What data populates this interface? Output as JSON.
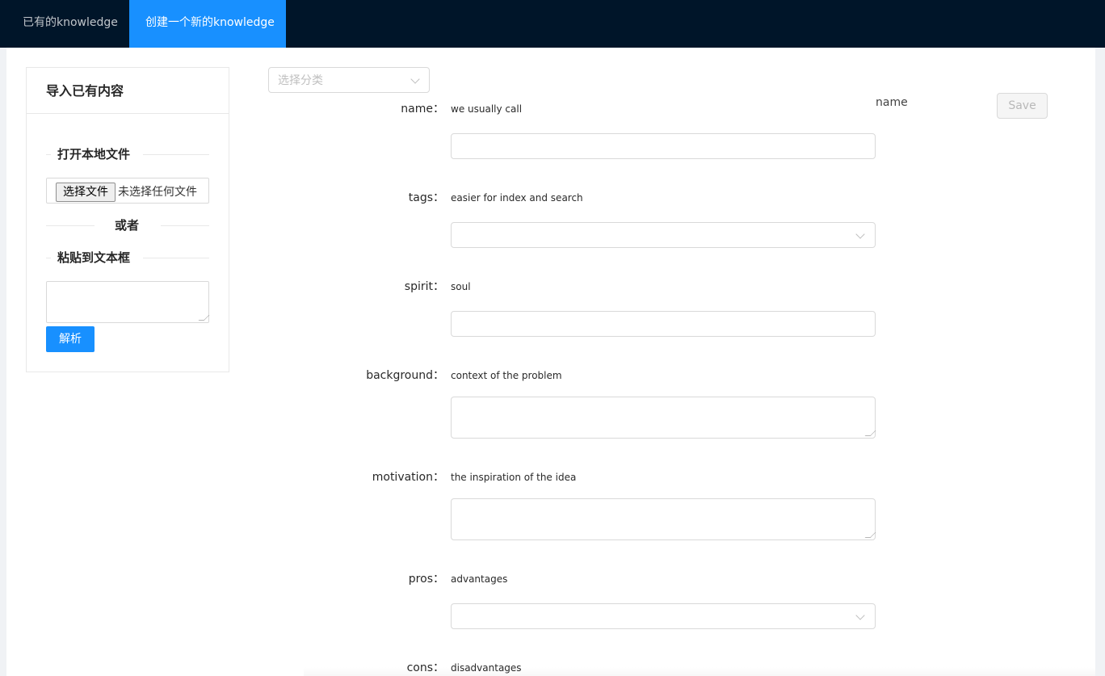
{
  "nav": {
    "tabs": [
      {
        "label": "已有的knowledge",
        "active": false
      },
      {
        "label": "创建一个新的knowledge",
        "active": true
      }
    ]
  },
  "import_panel": {
    "title": "导入已有内容",
    "open_file_label": "打开本地文件",
    "file_button_label": "选择文件",
    "file_status": "未选择任何文件",
    "or_label": "或者",
    "paste_label": "粘贴到文本框",
    "paste_value": "",
    "parse_button_label": "解析"
  },
  "form": {
    "category_placeholder": "选择分类",
    "name_preview": "name",
    "save_label": "Save",
    "fields": [
      {
        "label": "name",
        "hint": "we usually call",
        "type": "input",
        "value": ""
      },
      {
        "label": "tags",
        "hint": "easier for index and search",
        "type": "select",
        "value": ""
      },
      {
        "label": "spirit",
        "hint": "soul",
        "type": "input",
        "value": ""
      },
      {
        "label": "background",
        "hint": "context of the problem",
        "type": "textarea",
        "value": ""
      },
      {
        "label": "motivation",
        "hint": "the inspiration of the idea",
        "type": "textarea",
        "value": ""
      },
      {
        "label": "pros",
        "hint": "advantages",
        "type": "select",
        "value": ""
      },
      {
        "label": "cons",
        "hint": "disadvantages",
        "type": "select",
        "value": ""
      }
    ],
    "label_suffix": "："
  },
  "colors": {
    "nav_bg": "#001529",
    "primary": "#1890ff",
    "border": "#d9d9d9"
  }
}
